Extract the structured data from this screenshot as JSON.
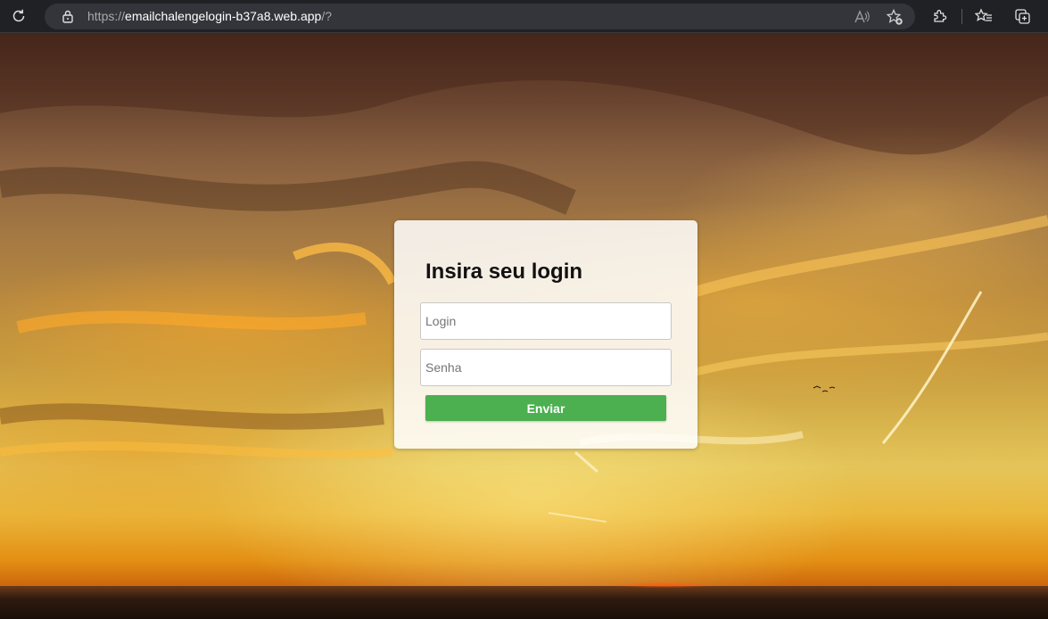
{
  "browser": {
    "url_scheme": "https://",
    "url_host": "emailchalengelogin-b37a8.web.app",
    "url_rest": "/?",
    "icons": [
      "refresh-icon",
      "lock-icon",
      "read-aloud-icon",
      "add-favorite-icon",
      "extensions-icon",
      "favorites-icon",
      "collections-icon"
    ]
  },
  "login": {
    "title": "Insira seu login",
    "login_placeholder": "Login",
    "password_placeholder": "Senha",
    "submit_label": "Enviar"
  },
  "colors": {
    "button": "#4caf50",
    "card": "#ffffff"
  }
}
